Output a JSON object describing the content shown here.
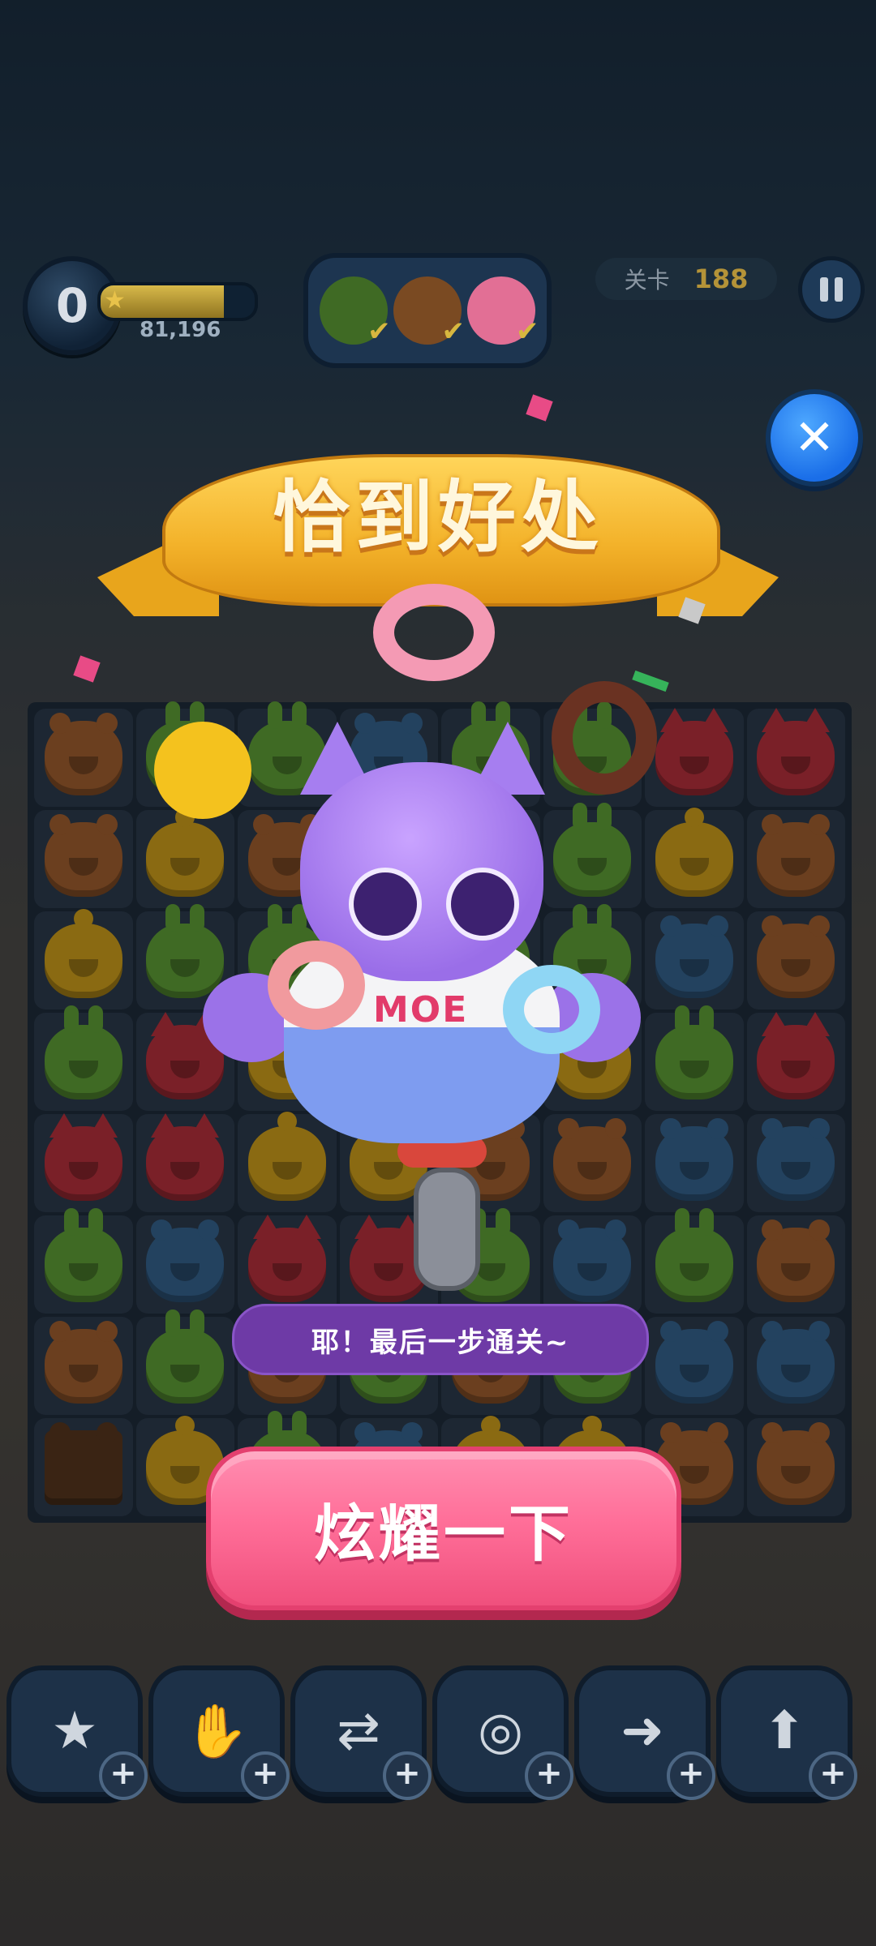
{
  "hud": {
    "score": "0",
    "score_points": "81,196",
    "progress_fraction": 0.8,
    "level_label": "关卡",
    "level_number": "188",
    "goals": [
      {
        "name": "rabbit",
        "color": "#3f6a24"
      },
      {
        "name": "bear",
        "color": "#7a4a22"
      },
      {
        "name": "donut",
        "color": "#e26f95"
      }
    ]
  },
  "banner": {
    "title": "恰到好处"
  },
  "speech": {
    "text": "耶！最后一步通关~"
  },
  "action": {
    "button_label": "炫耀一下"
  },
  "mascot": {
    "shirt_text": "MOE"
  },
  "board": {
    "rows": [
      [
        "bear",
        "rabbit",
        "rabbit",
        "mouse",
        "rabbit",
        "rabbit",
        "fox",
        "fox"
      ],
      [
        "bear",
        "chick",
        "bear",
        "bear",
        "rabbit",
        "rabbit",
        "chick",
        "bear"
      ],
      [
        "chick",
        "rabbit",
        "rabbit",
        "bear",
        "rabbit",
        "rabbit",
        "mouse",
        "bear"
      ],
      [
        "rabbit",
        "fox",
        "chick",
        "rabbit",
        "rabbit",
        "chick",
        "rabbit",
        "fox"
      ],
      [
        "fox",
        "fox",
        "chick",
        "chick",
        "bear",
        "bear",
        "mouse",
        "mouse"
      ],
      [
        "rabbit",
        "mouse",
        "fox",
        "fox",
        "rabbit",
        "mouse",
        "rabbit",
        "bear"
      ],
      [
        "bear",
        "rabbit",
        "bear",
        "rabbit",
        "bear",
        "rabbit",
        "mouse",
        "mouse"
      ],
      [
        "choc",
        "chick",
        "rabbit",
        "mouse",
        "chick",
        "chick",
        "bear",
        "bear"
      ]
    ]
  },
  "boosters": [
    {
      "name": "star-wand",
      "icon": "★"
    },
    {
      "name": "glove-x3",
      "icon": "✋"
    },
    {
      "name": "swap",
      "icon": "⇄"
    },
    {
      "name": "goggles",
      "icon": "◎"
    },
    {
      "name": "rocket-right",
      "icon": "➜"
    },
    {
      "name": "rocket-up",
      "icon": "⬆"
    }
  ],
  "booster_plus": "+",
  "close_icon": "✕"
}
